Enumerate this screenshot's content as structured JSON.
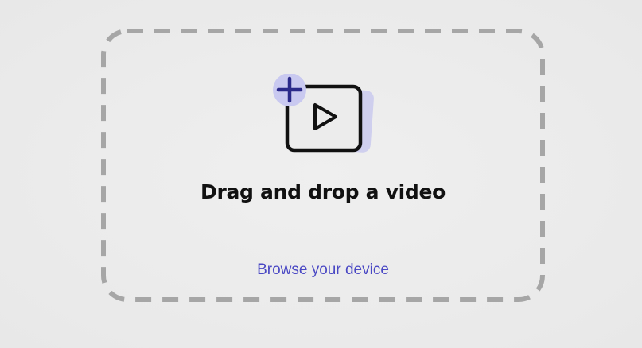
{
  "dropzone": {
    "headline": "Drag and drop a video",
    "browse_label": "Browse your device",
    "icon": "add-video-icon"
  },
  "colors": {
    "background": "#ececec",
    "dash_border": "#a6a6a6",
    "accent": "#4a48c4",
    "icon_plus_bg": "#c9c9f0",
    "icon_plus_stroke": "#2b2a8a",
    "icon_shadow": "#cfcfee",
    "icon_stroke": "#111111",
    "headline": "#111111"
  }
}
